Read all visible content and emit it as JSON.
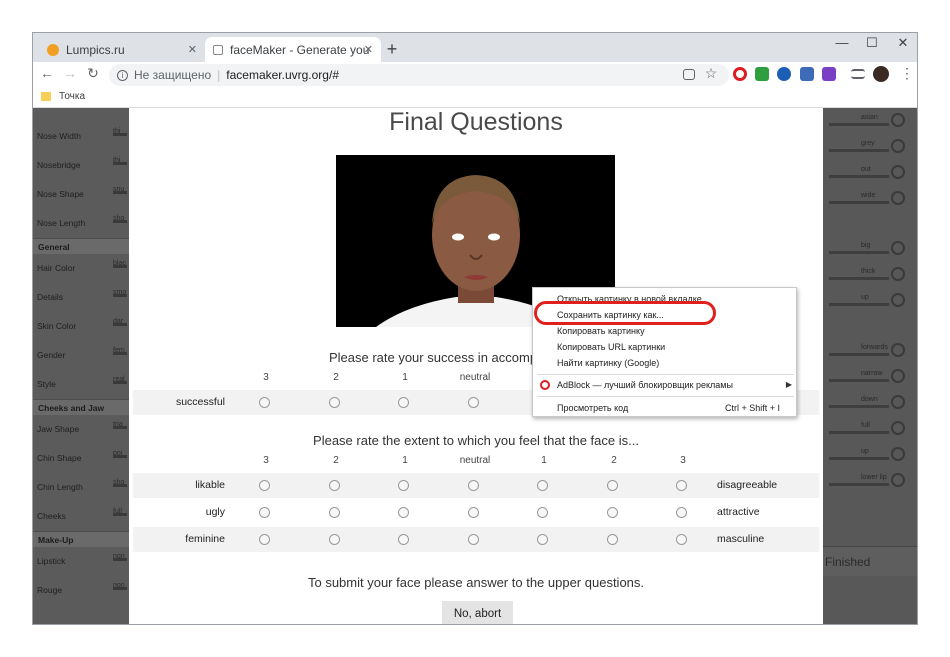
{
  "browser": {
    "tabs": [
      {
        "title": "Lumpics.ru",
        "close": "✕"
      },
      {
        "title": "faceMaker - Generate your favou",
        "close": "✕"
      }
    ],
    "new_tab": "+",
    "window_controls": {
      "minimize": "—",
      "maximize": "☐",
      "close": "✕"
    },
    "security_label": "Не защищено",
    "url": "facemaker.uvrg.org/#",
    "bookmark": "Точка"
  },
  "sidebar": {
    "items_top": [
      {
        "label": "Nose Width",
        "value": "thi"
      },
      {
        "label": "Nosebridge",
        "value": "thi"
      },
      {
        "label": "Nose Shape",
        "value": "snu"
      },
      {
        "label": "Nose Length",
        "value": "sho"
      }
    ],
    "general_head": "General",
    "general_items": [
      {
        "label": "Hair Color",
        "value": "blac"
      },
      {
        "label": "Details",
        "value": "smo"
      },
      {
        "label": "Skin Color",
        "value": "dar"
      },
      {
        "label": "Gender",
        "value": "fem"
      },
      {
        "label": "Style",
        "value": "real"
      }
    ],
    "cheeks_head": "Cheeks and Jaw",
    "cheeks_items": [
      {
        "label": "Jaw Shape",
        "value": "tria"
      },
      {
        "label": "Chin Shape",
        "value": "poi"
      },
      {
        "label": "Chin Length",
        "value": "sho"
      },
      {
        "label": "Cheeks",
        "value": "full"
      }
    ],
    "makeup_head": "Make-Up",
    "makeup_items": [
      {
        "label": "Lipstick",
        "value": "non"
      },
      {
        "label": "Rouge",
        "value": "non"
      }
    ]
  },
  "right_panel": {
    "labels": [
      "asian",
      "grey",
      "out",
      "wide",
      "big",
      "thick",
      "up",
      "forwards",
      "narrow",
      "down",
      "full",
      "up",
      "lower lip"
    ],
    "finished": "Finished"
  },
  "main": {
    "title": "Final Questions",
    "q1": "Please rate your success in accomplishing the task",
    "q1_scale": [
      "3",
      "2",
      "1",
      "neutral"
    ],
    "q1_rows": [
      {
        "left": "successful"
      }
    ],
    "q2": "Please rate the extent to which you feel that the face is...",
    "q2_scale": [
      "3",
      "2",
      "1",
      "neutral",
      "1",
      "2",
      "3"
    ],
    "q2_rows": [
      {
        "left": "likable",
        "right": "disagreeable"
      },
      {
        "left": "ugly",
        "right": "attractive"
      },
      {
        "left": "feminine",
        "right": "masculine"
      }
    ],
    "submit_text": "To submit your face please answer to the upper questions.",
    "abort_label": "No, abort"
  },
  "context_menu": {
    "items": [
      "Открыть картинку в новой вкладке",
      "Сохранить картинку как...",
      "Копировать картинку",
      "Копировать URL картинки",
      "Найти картинку (Google)"
    ],
    "adblock": "AdBlock — лучший блокировщик рекламы",
    "inspect": "Просмотреть код",
    "inspect_shortcut": "Ctrl + Shift + I"
  },
  "colors": {
    "highlight": "#e0201d",
    "chrome_frame": "#dee1e6"
  }
}
